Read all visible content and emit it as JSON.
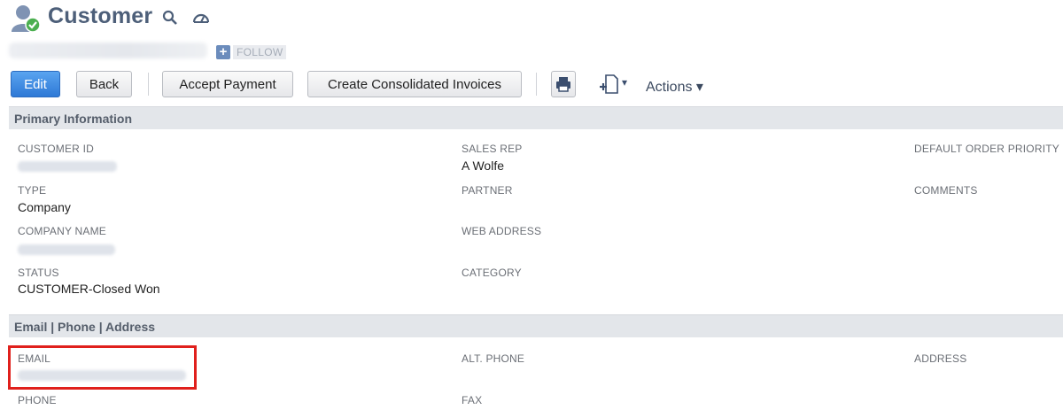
{
  "header": {
    "title": "Customer",
    "follow_label": "FOLLOW",
    "follow_plus": "+"
  },
  "toolbar": {
    "edit": "Edit",
    "back": "Back",
    "accept_payment": "Accept Payment",
    "create_consolidated": "Create Consolidated Invoices",
    "actions": "Actions ▾",
    "new_doc_caret": "▾"
  },
  "sections": {
    "primary": "Primary Information",
    "contact": "Email | Phone | Address"
  },
  "primary": {
    "customer_id_label": "CUSTOMER ID",
    "type_label": "TYPE",
    "type_value": "Company",
    "company_name_label": "COMPANY NAME",
    "status_label": "STATUS",
    "status_value": "CUSTOMER-Closed Won",
    "sales_rep_label": "SALES REP",
    "sales_rep_value": "A Wolfe",
    "partner_label": "PARTNER",
    "web_address_label": "WEB ADDRESS",
    "category_label": "CATEGORY",
    "default_order_priority_label": "DEFAULT ORDER PRIORITY",
    "comments_label": "COMMENTS"
  },
  "contact": {
    "email_label": "EMAIL",
    "phone_label": "PHONE",
    "alt_phone_label": "ALT. PHONE",
    "fax_label": "FAX",
    "address_label": "ADDRESS"
  },
  "colors": {
    "title": "#4d5f79",
    "edit_button": "#2e79d6",
    "section_bar": "#e3e6ea",
    "highlight": "#e0201c"
  },
  "icons": [
    "customer-icon",
    "search-icon",
    "dashboard-icon",
    "print-icon",
    "new-document-icon"
  ]
}
